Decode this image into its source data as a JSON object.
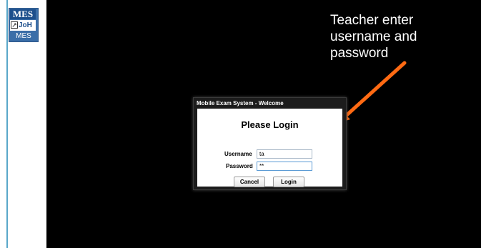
{
  "desktop": {
    "shortcut": {
      "logo_top": "MES",
      "logo_bottom": "JoH",
      "label": "MES"
    }
  },
  "annotation": {
    "text": "Teacher enter\nusername and\npassword",
    "arrow_color": "#ff6a13"
  },
  "dialog": {
    "title": "Mobile Exam System - Welcome",
    "heading": "Please Login",
    "username_label": "Username",
    "username_value": "ta",
    "password_label": "Password",
    "password_value": "**",
    "cancel_label": "Cancel",
    "login_label": "Login"
  }
}
